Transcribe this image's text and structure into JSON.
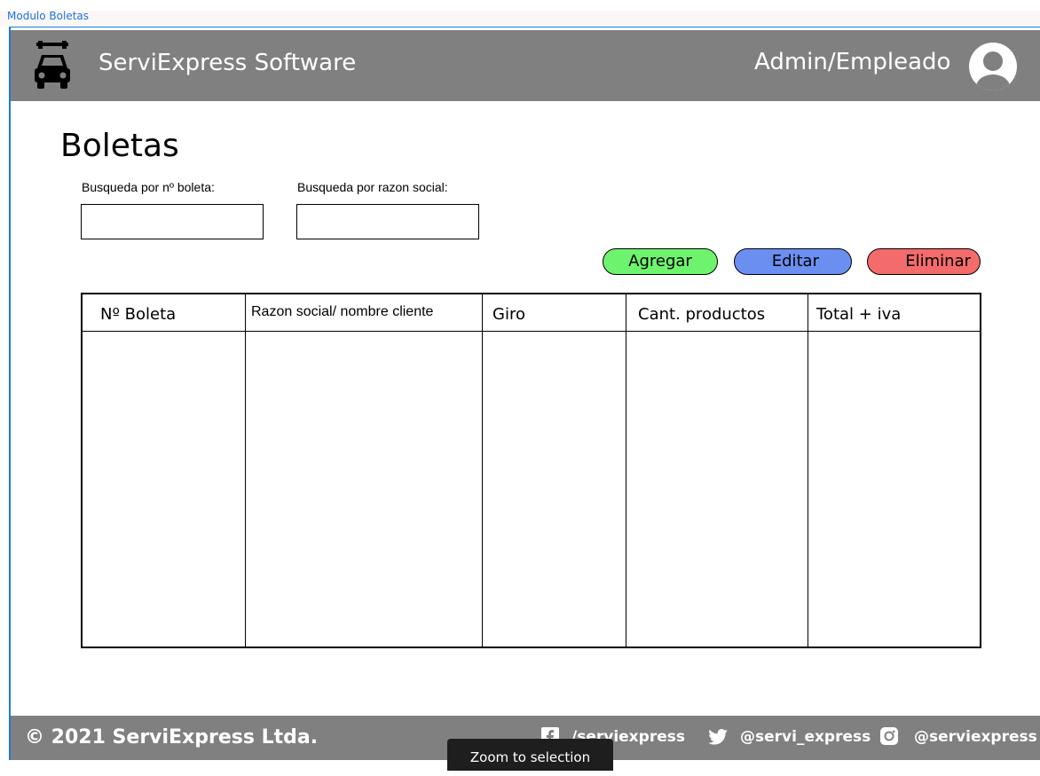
{
  "frame": {
    "label": "Modulo Boletas"
  },
  "header": {
    "app_title": "ServiExpress Software",
    "role": "Admin/Empleado",
    "logo_icon": "car-icon",
    "avatar_icon": "user-avatar-icon",
    "background": "#808080"
  },
  "page": {
    "title": "Boletas",
    "search_boleta_label": "Busqueda por nº boleta:",
    "search_boleta_value": "",
    "search_razon_label": "Busqueda por razon social:",
    "search_razon_value": ""
  },
  "actions": {
    "add_label": "Agregar",
    "add_color": "#6ef36e",
    "edit_label": "Editar",
    "edit_color": "#6b8ff0",
    "delete_label": "Eliminar",
    "delete_color": "#f36b6b"
  },
  "table": {
    "columns": [
      "Nº Boleta",
      "Razon social/ nombre cliente",
      "Giro",
      "Cant. productos",
      "Total + iva"
    ],
    "rows": []
  },
  "footer": {
    "copyright": "© 2021 ServiExpress Ltda.",
    "facebook": "/serviexpress",
    "twitter": "@servi_express",
    "instagram": "@serviexpress"
  },
  "tooltip": {
    "text": "Zoom to selection"
  }
}
